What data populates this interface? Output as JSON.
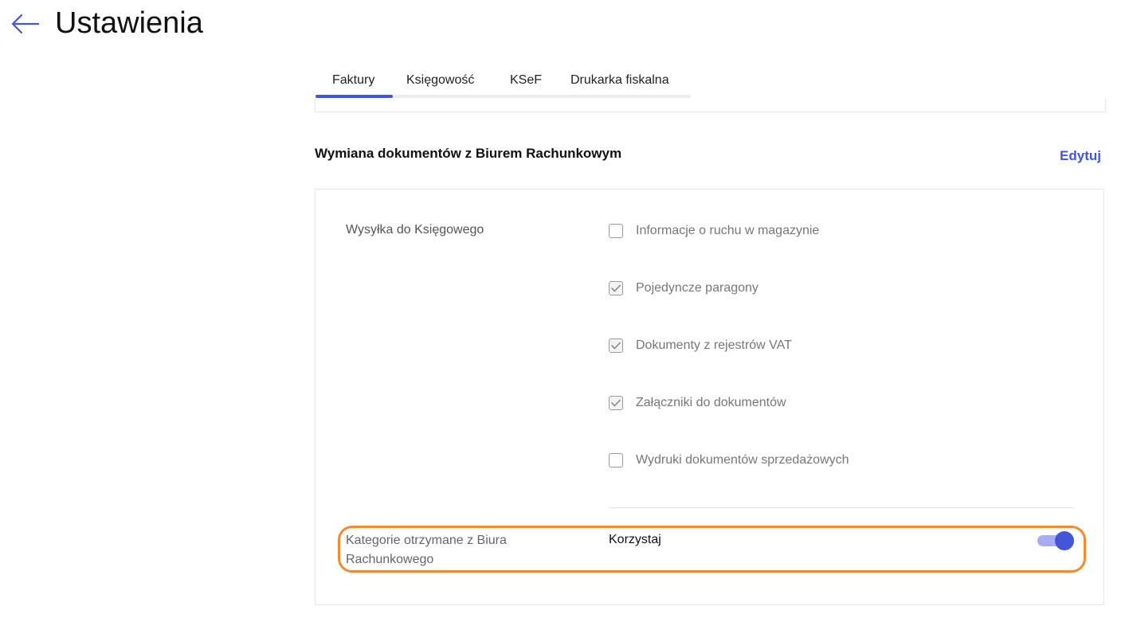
{
  "header": {
    "title": "Ustawienia",
    "back_icon": "arrow-left-icon"
  },
  "tabs": [
    {
      "label": "Faktury",
      "active": true
    },
    {
      "label": "Księgowość",
      "active": false
    },
    {
      "label": "KSeF",
      "active": false
    },
    {
      "label": "Drukarka fiskalna",
      "active": false
    }
  ],
  "section": {
    "title": "Wymiana dokumentów z Biurem Rachunkowym",
    "edit_label": "Edytuj"
  },
  "shipping": {
    "label": "Wysyłka do Księgowego",
    "options": [
      {
        "label": "Informacje o ruchu w magazynie",
        "checked": false
      },
      {
        "label": "Pojedyncze paragony",
        "checked": true
      },
      {
        "label": "Dokumenty z rejestrów VAT",
        "checked": true
      },
      {
        "label": "Załączniki do dokumentów",
        "checked": true
      },
      {
        "label": "Wydruki dokumentów sprzedażowych",
        "checked": false
      }
    ]
  },
  "categories": {
    "label": "Kategorie otrzymane z Biura Rachunkowego",
    "value_label": "Korzystaj",
    "toggle_on": true
  },
  "colors": {
    "accent": "#4355d8",
    "highlight": "#f28a2e",
    "toggle_track": "#a7adf0"
  }
}
